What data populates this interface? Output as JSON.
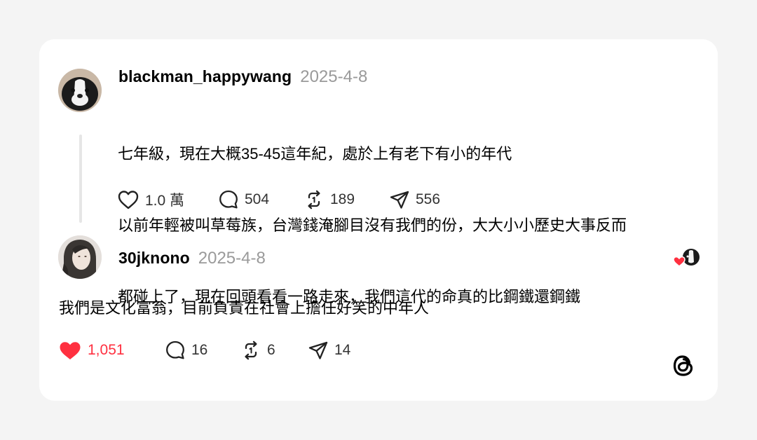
{
  "post": {
    "username": "blackman_happywang",
    "date": "2025-4-8",
    "lines": [
      "七年級，現在大概35-45這年紀，處於上有老下有小的年代",
      "以前年輕被叫草莓族，台灣錢淹腳目沒有我們的份，大大小小歷史大事反而",
      "都碰上了，現在回頭看看一路走來，我們這代的命真的比鋼鐵還鋼鐵"
    ],
    "likes": "1.0 萬",
    "comments": "504",
    "reposts": "189",
    "shares": "556"
  },
  "reply": {
    "username": "30jknono",
    "date": "2025-4-8",
    "text": "我們是文化富翁，目前負責在社會上擔任好笑的中年人",
    "likes": "1,051",
    "comments": "16",
    "reposts": "6",
    "shares": "14",
    "liked": true
  },
  "colors": {
    "like_active": "#ff3040",
    "date": "#9a9a9a",
    "background": "#f4f4f4",
    "card": "#ffffff"
  },
  "icons": [
    "heart-icon",
    "comment-icon",
    "repost-icon",
    "share-icon",
    "threads-logo-icon"
  ]
}
